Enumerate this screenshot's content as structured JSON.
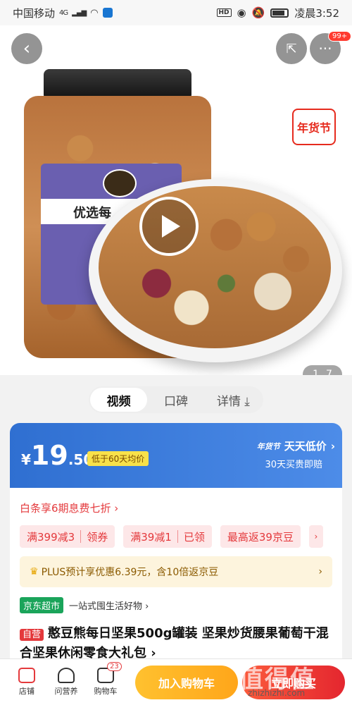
{
  "status_bar": {
    "carrier": "中国移动",
    "network": "4G",
    "hd_label": "HD",
    "time": "凌晨3:52"
  },
  "hero": {
    "jar_label_text": "优选每",
    "festival_tag": "年货节",
    "image_index": "1",
    "image_total": "7",
    "more_badge": "99+"
  },
  "media_tabs": [
    "视频",
    "口碑",
    "详情 ⤓"
  ],
  "price_section": {
    "currency": "¥",
    "price_int": "19",
    "price_dec": ".50",
    "low_tag": "低于60天均价",
    "daily_low_prefix": "年货节",
    "daily_low": "天天低价",
    "daily_sub": "30天买贵即赔"
  },
  "baitiao": "白条享6期息费七折 ›",
  "coupons": [
    {
      "main": "满399减3",
      "action": "领券"
    },
    {
      "main": "满39减1",
      "action": "已领"
    },
    {
      "main": "最高返39京豆",
      "action": ""
    }
  ],
  "plus_row": {
    "text": "PLUS预计享优惠6.39元，含10倍返京豆",
    "arrow": "›"
  },
  "store_row": {
    "tag": "京东超市",
    "text": "一站式囤生活好物 ›"
  },
  "product": {
    "self_tag": "自营",
    "title": "憨豆熊每日坚果500g罐装 坚果炒货腰果葡萄干混合坚果休闲零食大礼包 ›"
  },
  "bottom_bar": {
    "store": "店铺",
    "consult": "问营养",
    "cart": "购物车",
    "cart_count": "23",
    "add_cart": "加入购物车",
    "buy_now": "立即购买"
  },
  "watermark": {
    "text": "值得值",
    "url": "zhizhizhi.com"
  }
}
